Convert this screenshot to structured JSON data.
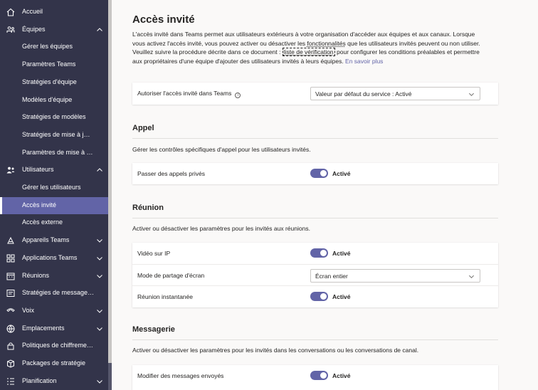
{
  "sidebar": {
    "items": [
      {
        "label": "Accueil",
        "icon": "home-icon",
        "type": "top"
      },
      {
        "label": "Équipes",
        "icon": "teams-icon",
        "type": "top",
        "chevron": "up"
      },
      {
        "label": "Gérer les équipes",
        "type": "sub"
      },
      {
        "label": "Paramètres Teams",
        "type": "sub"
      },
      {
        "label": "Stratégies d'équipe",
        "type": "sub"
      },
      {
        "label": "Modèles d'équipe",
        "type": "sub"
      },
      {
        "label": "Stratégies de modèles",
        "type": "sub"
      },
      {
        "label": "Stratégies de mise à jou...",
        "type": "sub"
      },
      {
        "label": "Paramètres de mise à ni...",
        "type": "sub"
      },
      {
        "label": "Utilisateurs",
        "icon": "users-icon",
        "type": "top",
        "chevron": "up"
      },
      {
        "label": "Gérer les utilisateurs",
        "type": "sub"
      },
      {
        "label": "Accès invité",
        "type": "sub",
        "active": true
      },
      {
        "label": "Accès externe",
        "type": "sub"
      },
      {
        "label": "Appareils Teams",
        "icon": "devices-icon",
        "type": "top",
        "chevron": "down"
      },
      {
        "label": "Applications Teams",
        "icon": "apps-icon",
        "type": "top",
        "chevron": "down"
      },
      {
        "label": "Réunions",
        "icon": "calendar-icon",
        "type": "top",
        "chevron": "down"
      },
      {
        "label": "Stratégies de messagerie",
        "icon": "messaging-icon",
        "type": "top"
      },
      {
        "label": "Voix",
        "icon": "voice-icon",
        "type": "top",
        "chevron": "down"
      },
      {
        "label": "Emplacements",
        "icon": "globe-icon",
        "type": "top",
        "chevron": "down"
      },
      {
        "label": "Politiques de chiffremen...",
        "icon": "lock-icon",
        "type": "top"
      },
      {
        "label": "Packages de stratégie",
        "icon": "package-icon",
        "type": "top"
      },
      {
        "label": "Planification",
        "icon": "planning-icon",
        "type": "top",
        "chevron": "down"
      }
    ]
  },
  "page": {
    "title": "Accès invité",
    "intro": {
      "part1": "L'accès invité dans Teams permet aux utilisateurs extérieurs à votre organisation d'accéder aux équipes et aux canaux. Lorsque vous activez l'accès invité, vous pouvez activer ou désactiver les ",
      "link1": "fonctionnalités",
      "part2": " que les utilisateurs invités peuvent ou non utiliser. Veuillez suivre la procédure décrite dans ce document : ",
      "link2": "liste de vérification",
      "part3": " pour configurer les conditions préalables et permettre aux propriétaires d'une équipe d'ajouter des utilisateurs invités à leurs équipes. ",
      "link3": "En savoir plus"
    },
    "guest_setting": {
      "label": "Autoriser l'accès invité dans Teams",
      "info_icon": "i",
      "value": "Valeur par défaut du service : Activé"
    },
    "appel": {
      "heading": "Appel",
      "description": "Gérer les contrôles spécifiques d'appel pour les utilisateurs invités.",
      "rows": [
        {
          "label": "Passer des appels privés",
          "state": "Activé"
        }
      ]
    },
    "reunion": {
      "heading": "Réunion",
      "description": "Activer ou désactiver les paramètres pour les invités aux réunions.",
      "video_label": "Vidéo sur IP",
      "video_state": "Activé",
      "screen_label": "Mode de partage d'écran",
      "screen_value": "Écran entier",
      "instant_label": "Réunion instantanée",
      "instant_state": "Activé"
    },
    "messagerie": {
      "heading": "Messagerie",
      "description": "Activer ou désactiver les paramètres pour les invités dans les conversations ou les conversations de canal.",
      "edit_label": "Modifier des messages envoyés",
      "edit_state": "Activé"
    }
  },
  "colors": {
    "sidebar_bg": "#33344a",
    "accent": "#6264a7",
    "page_bg": "#faf9f8"
  }
}
